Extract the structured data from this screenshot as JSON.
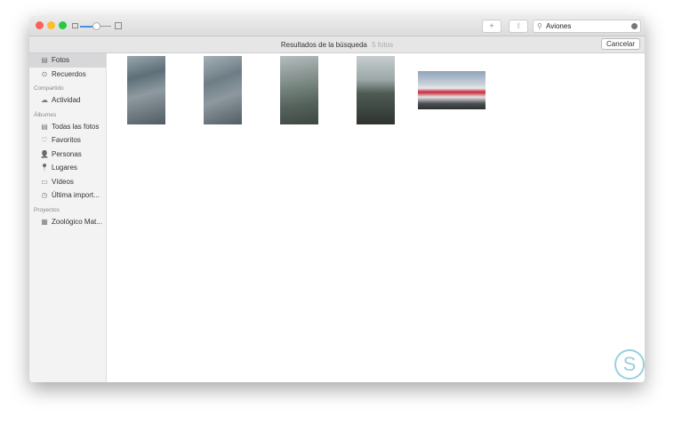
{
  "toolbar": {
    "search_value": "Aviones",
    "add": "+",
    "share": "⇪"
  },
  "subheader": {
    "title": "Resultados de la búsqueda",
    "count": "5 fotos",
    "cancel": "Cancelar"
  },
  "sidebar": {
    "items": [
      {
        "label": "Fotos",
        "icon": "▤"
      },
      {
        "label": "Recuerdos",
        "icon": "⊙"
      }
    ],
    "shared_header": "Compartido",
    "shared": [
      {
        "label": "Actividad",
        "icon": "☁"
      }
    ],
    "albums_header": "Álbumes",
    "albums": [
      {
        "label": "Todas las fotos",
        "icon": "▤"
      },
      {
        "label": "Favoritos",
        "icon": "♡"
      },
      {
        "label": "Personas",
        "icon": "👤"
      },
      {
        "label": "Lugares",
        "icon": "📍"
      },
      {
        "label": "Vídeos",
        "icon": "▭"
      },
      {
        "label": "Última import...",
        "icon": "◷"
      }
    ],
    "projects_header": "Proyectos",
    "projects": [
      {
        "label": "Zoológico Mat...",
        "icon": "▦"
      }
    ]
  },
  "colors": {
    "close": "#fc5f57",
    "min": "#fdbc2e",
    "max": "#28c840",
    "accent": "#4a90e2"
  }
}
